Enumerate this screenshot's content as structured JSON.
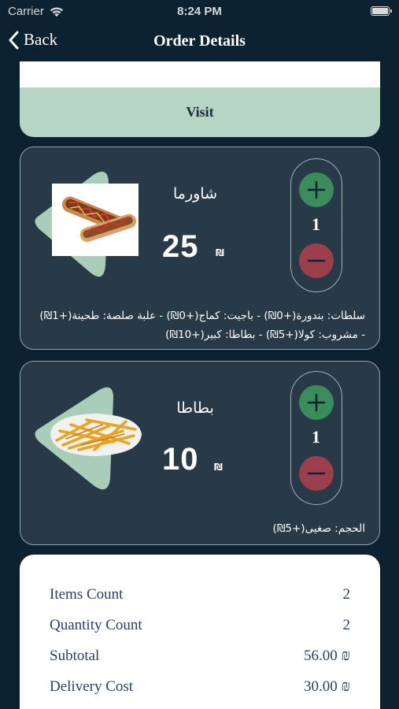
{
  "status_bar": {
    "carrier": "Carrier",
    "time": "8:24 PM",
    "icons": [
      "wifi-icon",
      "battery-icon"
    ]
  },
  "nav": {
    "back_label": "Back",
    "title": "Order Details",
    "back_icon": "chevron-left-icon"
  },
  "visit": {
    "label": "Visit"
  },
  "colors": {
    "background": "#0c2230",
    "card": "#283948",
    "accent_mint": "#b6d5c5",
    "plus_green": "#3a8c5d",
    "minus_red": "#9b3f4d",
    "summary_text": "#27406a"
  },
  "items": [
    {
      "name": "شاورما",
      "price": "25",
      "currency": "₪",
      "quantity": "1",
      "options": "سلطات: بندورة(+0₪) - باجيت: كماج(+0₪) - علبة صلصة: طحينة(+1₪) - مشروب: كولا(+5₪) - بطاطا: كبير(+10₪)",
      "image": "shawarma-image"
    },
    {
      "name": "بطاطا",
      "price": "10",
      "currency": "₪",
      "quantity": "1",
      "options": "الحجم: صغيى(+5₪)",
      "image": "fries-image"
    }
  ],
  "summary": {
    "items_count_label": "Items Count",
    "items_count_value": "2",
    "quantity_count_label": "Quantity Count",
    "quantity_count_value": "2",
    "subtotal_label": "Subtotal",
    "subtotal_value": "56.00 ₪",
    "delivery_label": "Delivery Cost",
    "delivery_value": "30.00 ₪"
  }
}
